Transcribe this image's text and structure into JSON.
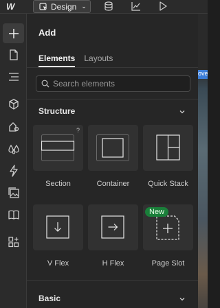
{
  "topbar": {
    "logo_text": "W",
    "mode_label": "Design",
    "mode_icon": "cursor-icon",
    "icons": [
      "database-icon",
      "chart-icon",
      "play-icon"
    ]
  },
  "rail": {
    "items": [
      "add-icon",
      "page-icon",
      "navigator-icon",
      "components-icon",
      "styles-icon",
      "variables-icon",
      "interactions-icon",
      "assets-icon",
      "library-icon",
      "apps-icon"
    ]
  },
  "panel": {
    "title": "Add",
    "tabs": [
      {
        "label": "Elements",
        "active": true
      },
      {
        "label": "Layouts",
        "active": false
      }
    ],
    "search": {
      "placeholder": "Search elements",
      "value": ""
    },
    "sections": [
      {
        "title": "Structure",
        "items": [
          {
            "label": "Section",
            "badge": "?"
          },
          {
            "label": "Container",
            "badge": ""
          },
          {
            "label": "Quick Stack",
            "badge": ""
          },
          {
            "label": "V Flex",
            "badge": ""
          },
          {
            "label": "H Flex",
            "badge": ""
          },
          {
            "label": "Page Slot",
            "badge": "New"
          }
        ]
      },
      {
        "title": "Basic",
        "items": []
      }
    ]
  },
  "canvas": {
    "chip_text": "ove"
  },
  "colors": {
    "accent_new": "#1a7f3a",
    "panel_bg": "#262626",
    "card_bg": "#313131"
  }
}
